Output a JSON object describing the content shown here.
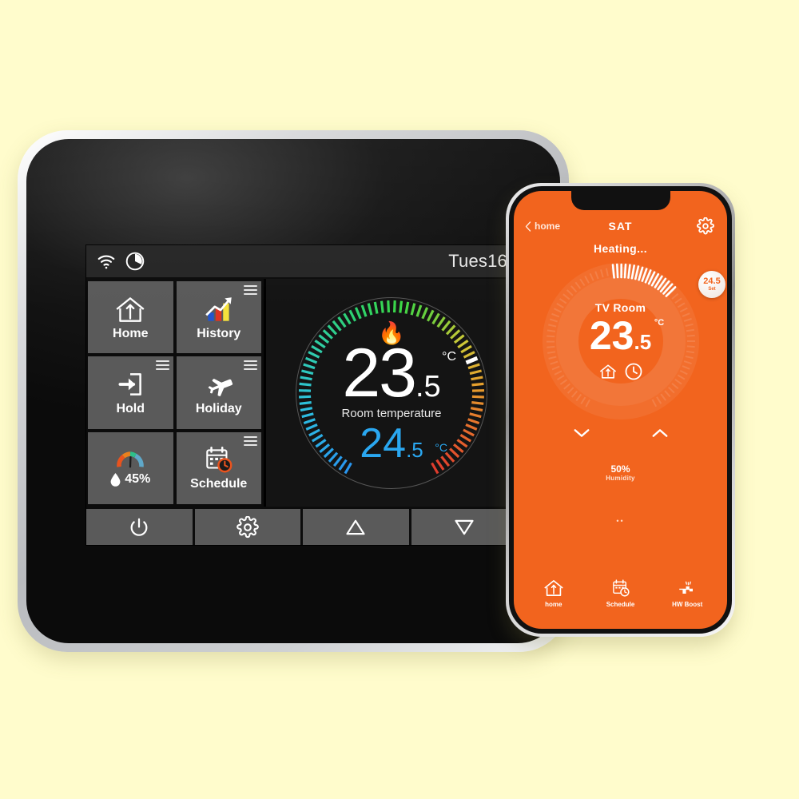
{
  "background_color": "#FFFCCC",
  "thermostat": {
    "statusbar": {
      "wifi_icon": "wifi-icon",
      "clock_icon": "clock-icon",
      "date": "Tues16"
    },
    "tiles": [
      {
        "label": "Home",
        "icon": "home-arrow-icon",
        "menu": false
      },
      {
        "label": "History",
        "icon": "bar-chart-icon",
        "menu": true
      },
      {
        "label": "Hold",
        "icon": "hold-arrow-icon",
        "menu": true
      },
      {
        "label": "Holiday",
        "icon": "airplane-icon",
        "menu": true
      },
      {
        "label": "45%",
        "icon": "humidity-gauge-icon",
        "menu": false
      },
      {
        "label": "Schedule",
        "icon": "calendar-clock-icon",
        "menu": true
      }
    ],
    "dial": {
      "flame_icon": "flame-icon",
      "current_temp_int": "23",
      "current_temp_dec": ".5",
      "current_unit": "°C",
      "caption": "Room temperature",
      "set_temp_int": "24",
      "set_temp_dec": ".5",
      "set_unit": "°C",
      "current_color": "#FFFFFF",
      "set_color": "#2AA7F0"
    },
    "nav_buttons": [
      {
        "icon": "power-icon"
      },
      {
        "icon": "gear-icon"
      },
      {
        "icon": "triangle-up-icon"
      },
      {
        "icon": "triangle-down-icon"
      }
    ]
  },
  "phone": {
    "accent_color": "#F2641E",
    "header": {
      "back_label": "home",
      "back_icon": "chevron-left-icon",
      "title": "SAT",
      "gear_icon": "gear-icon"
    },
    "status_text": "Heating...",
    "dial": {
      "room_name": "TV Room",
      "temp_int": "23",
      "temp_dec": ".5",
      "unit": "°C",
      "knob_value": "24.5",
      "knob_label": "Set",
      "mode_icons": [
        "home-arrow-icon",
        "clock-icon"
      ],
      "down_icon": "chevron-down-icon",
      "up_icon": "chevron-up-icon"
    },
    "humidity": {
      "value": "50%",
      "label": "Humidity"
    },
    "page_dots": "••",
    "nav": [
      {
        "label": "home",
        "icon": "home-arrow-icon"
      },
      {
        "label": "Schedule",
        "icon": "calendar-clock-icon"
      },
      {
        "label": "HW Boost",
        "icon": "faucet-icon"
      }
    ]
  }
}
